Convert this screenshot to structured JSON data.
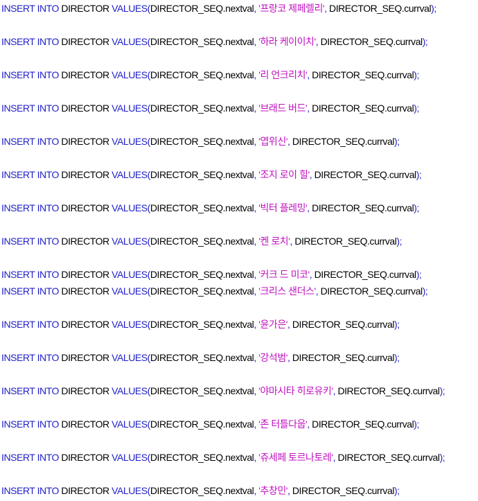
{
  "syntax": {
    "kw_insert": "INSERT INTO",
    "table": "DIRECTOR",
    "kw_values": "VALUES(",
    "seq_next": "DIRECTOR_SEQ.nextval",
    "comma": ", ",
    "seq_curr": "DIRECTOR_SEQ.currval",
    "close": ");",
    "colors": {
      "keyword": "#2020c8",
      "string": "#c010c0",
      "text": "#000000"
    }
  },
  "lines": [
    {
      "name": "'프랑코 제페렐리'"
    },
    {
      "name": "'하라 케이이치'"
    },
    {
      "name": "'리 언크리치'"
    },
    {
      "name": "'브래드 버드'"
    },
    {
      "name": "'엽위신'"
    },
    {
      "name": "'조지 로이 힐'"
    },
    {
      "name": "'빅터 플레밍'"
    },
    {
      "name": "'켄 로치'"
    },
    {
      "name": "'커크 드 미코'"
    },
    {
      "name": "'크리스 샌더스'"
    },
    {
      "name": "'윤가은'"
    },
    {
      "name": "'강석범'"
    },
    {
      "name": "'야마시타 히로유키'"
    },
    {
      "name": "'존 터틀다웁'"
    },
    {
      "name": "'쥬세페 토르나토레'"
    },
    {
      "name": "'추창민'"
    }
  ]
}
